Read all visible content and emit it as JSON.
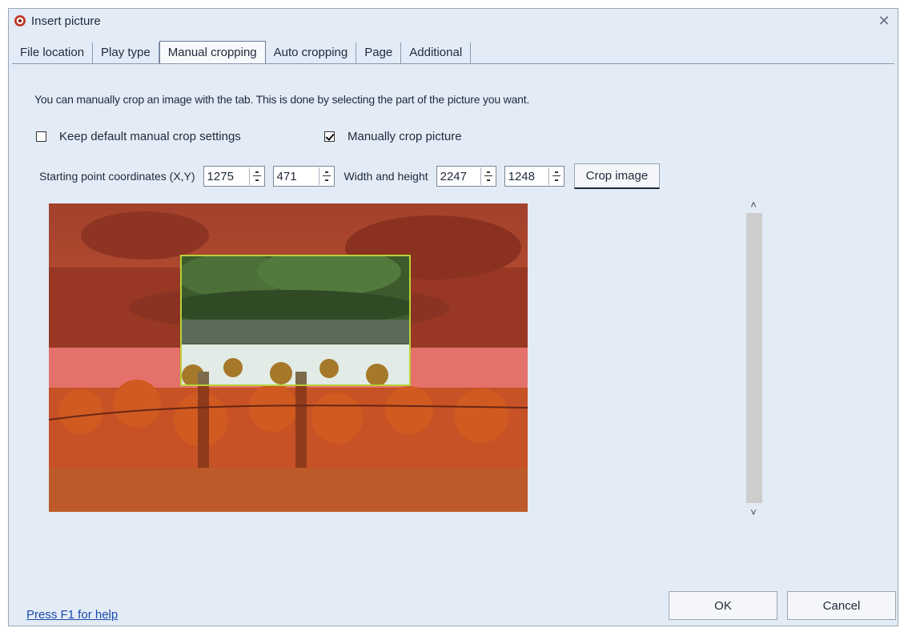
{
  "window": {
    "title": "Insert picture",
    "close_glyph": "✕"
  },
  "tabs": [
    {
      "label": "File location"
    },
    {
      "label": "Play type"
    },
    {
      "label": "Manual cropping",
      "active": true
    },
    {
      "label": "Auto cropping"
    },
    {
      "label": "Page"
    },
    {
      "label": "Additional"
    }
  ],
  "manual_crop": {
    "intro": "You can manually crop an image with the tab.  This is done by selecting the part of the picture you want.",
    "keep_default_label": "Keep default manual crop settings",
    "keep_default_checked": false,
    "manual_crop_label": "Manually crop picture",
    "manual_crop_checked": true,
    "start_label": "Starting point coordinates (X,Y)",
    "start_x": "1275",
    "start_y": "471",
    "size_label": "Width and height",
    "width": "2247",
    "height": "1248",
    "crop_button": "Crop image"
  },
  "scrollbar": {
    "up_glyph": "˄",
    "down_glyph": "˅"
  },
  "footer": {
    "help_link": "Press F1 for help",
    "ok": "OK",
    "cancel": "Cancel"
  },
  "colors": {
    "dialog_bg": "#e3ebf6",
    "selection_border": "#b7d238",
    "link": "#1a4aa8"
  }
}
